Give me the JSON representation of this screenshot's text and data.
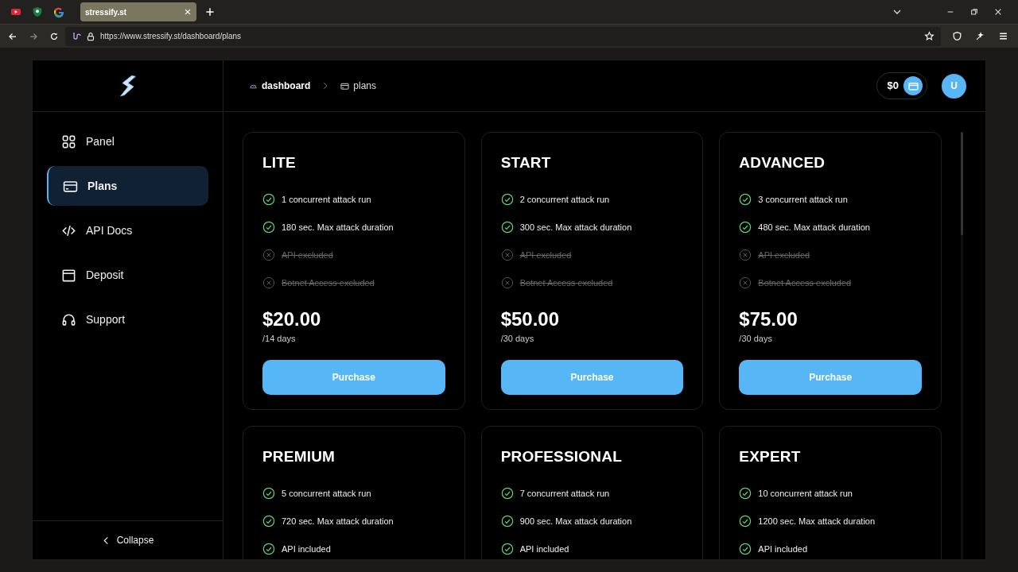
{
  "browser": {
    "pinned_tabs": [
      {
        "kind": "video"
      },
      {
        "kind": "shield"
      },
      {
        "kind": "google"
      }
    ],
    "tabs": [
      {
        "title": "stressify.st",
        "selected": true
      }
    ],
    "url": "https://www.stressify.st/dashboard/plans"
  },
  "sidebar": {
    "items": [
      {
        "label": "Panel",
        "kind": "grid",
        "selected": false
      },
      {
        "label": "Plans",
        "kind": "card",
        "selected": true
      },
      {
        "label": "API Docs",
        "kind": "code",
        "selected": false
      },
      {
        "label": "Deposit",
        "kind": "wallet",
        "selected": false
      },
      {
        "label": "Support",
        "kind": "headset",
        "selected": false
      }
    ],
    "collapse": "Collapse"
  },
  "breadcrumb": [
    {
      "label": "dashboard",
      "kind": "gauge"
    },
    {
      "label": "plans",
      "kind": "card"
    }
  ],
  "balance": "$0",
  "avatar": "U",
  "plans": [
    {
      "name": "LITE",
      "price": "$20.00",
      "period": "/14 days",
      "button": "Purchase",
      "features": [
        {
          "text": "1 concurrent attack run",
          "included": true
        },
        {
          "text": "180 sec. Max attack duration",
          "included": true
        },
        {
          "text": "API excluded",
          "included": false
        },
        {
          "text": "Botnet Access excluded",
          "included": false
        }
      ]
    },
    {
      "name": "START",
      "price": "$50.00",
      "period": "/30 days",
      "button": "Purchase",
      "features": [
        {
          "text": "2 concurrent attack run",
          "included": true
        },
        {
          "text": "300 sec. Max attack duration",
          "included": true
        },
        {
          "text": "API excluded",
          "included": false
        },
        {
          "text": "Botnet Access excluded",
          "included": false
        }
      ]
    },
    {
      "name": "ADVANCED",
      "price": "$75.00",
      "period": "/30 days",
      "button": "Purchase",
      "features": [
        {
          "text": "3 concurrent attack run",
          "included": true
        },
        {
          "text": "480 sec. Max attack duration",
          "included": true
        },
        {
          "text": "API excluded",
          "included": false
        },
        {
          "text": "Botnet Access excluded",
          "included": false
        }
      ]
    },
    {
      "name": "PREMIUM",
      "features": [
        {
          "text": "5 concurrent attack run",
          "included": true
        },
        {
          "text": "720 sec. Max attack duration",
          "included": true
        },
        {
          "text": "API included",
          "included": true
        }
      ]
    },
    {
      "name": "PROFESSIONAL",
      "features": [
        {
          "text": "7 concurrent attack run",
          "included": true
        },
        {
          "text": "900 sec. Max attack duration",
          "included": true
        },
        {
          "text": "API included",
          "included": true
        }
      ]
    },
    {
      "name": "EXPERT",
      "features": [
        {
          "text": "10 concurrent attack run",
          "included": true
        },
        {
          "text": "1200 sec. Max attack duration",
          "included": true
        },
        {
          "text": "API included",
          "included": true
        }
      ]
    }
  ]
}
